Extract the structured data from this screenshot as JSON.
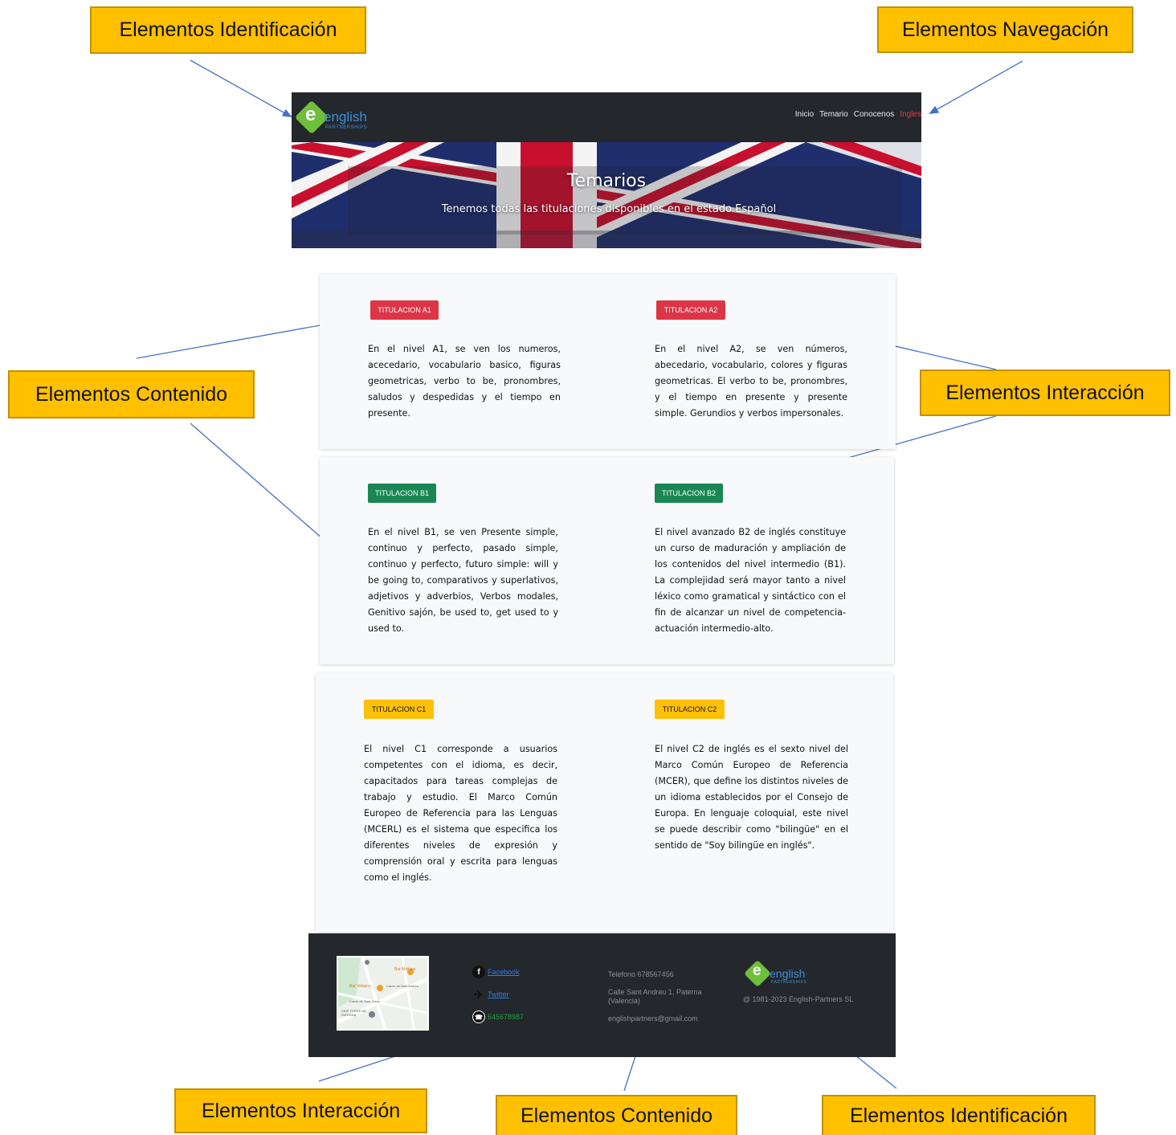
{
  "annotations": {
    "top_left": "Elementos Identificación",
    "top_right": "Elementos Navegación",
    "mid_left": "Elementos Contenido",
    "mid_right": "Elementos Interacción",
    "bottom_left": "Elementos Interacción",
    "bottom_center": "Elementos Contenido",
    "bottom_right": "Elementos Identificación"
  },
  "brand": {
    "mark": "e",
    "word": "english",
    "sub": "PARTNERSHIPS",
    "mark_color": "#6fbf3b",
    "word_color": "#3d8fd9"
  },
  "nav": {
    "items": [
      "Inicio",
      "Temario",
      "Conocenos"
    ],
    "active": "Ingles",
    "active_color": "#e23a4a"
  },
  "hero": {
    "title": "Temarios",
    "subtitle": "Tenemos todas las titulaciones disponibles en el estado Español"
  },
  "levels": [
    {
      "badge": "TITULACION A1",
      "color": "#dc3545",
      "text": "En el nivel A1, se ven los numeros, acecedario, vocabulario basico, figuras geometricas, verbo to be, pronombres, saludos y despedidas y el tiempo en presente."
    },
    {
      "badge": "TITULACION A2",
      "color": "#dc3545",
      "text": "En el nivel A2, se ven números, abecedario, vocabulario, colores y figuras geometricas. El verbo to be, pronombres, y el tiempo en presente y presente simple. Gerundios y verbos impersonales."
    },
    {
      "badge": "TITULACION B1",
      "color": "#198754",
      "text": "En el nivel B1, se ven Presente simple, continuo y perfecto, pasado simple, continuo y perfecto, futuro simple: will y be going to, comparativos y superlativos, adjetivos y adverbios, Verbos modales, Genitivo sajón, be used to, get used to y used to."
    },
    {
      "badge": "TITULACION B2",
      "color": "#198754",
      "text": "El nivel avanzado B2 de inglés constituye un curso de maduración y ampliación de los contenidos del nivel intermedio (B1). La complejidad será mayor tanto a nivel léxico como gramatical y sintáctico con el fin de alcanzar un nivel de competencia-actuación intermedio-alto."
    },
    {
      "badge": "TITULACION C1",
      "color": "#ffc107",
      "text": "El nivel C1 corresponde a usuarios competentes con el idioma, es decir, capacitados para tareas complejas de trabajo y estudio. El Marco Común Europeo de Referencia para las Lenguas (MCERL) es el sistema que especifica los diferentes niveles de expresión y comprensión oral y escrita para lenguas como el inglés."
    },
    {
      "badge": "TITULACION C2",
      "color": "#ffc107",
      "text": "El nivel C2 de inglés es el sexto nivel del Marco Común Europeo de Referencia (MCER), que define los distintos niveles de un idioma establecidos por el Consejo de Europa. En lenguaje coloquial, este nivel se puede describir como \"bilingüe\" en el sentido de \"Soy bilingüe en inglés\"."
    }
  ],
  "footer": {
    "social": [
      {
        "icon": "facebook-icon",
        "label": "Facebook"
      },
      {
        "icon": "twitter-icon",
        "label": "Twitter"
      },
      {
        "icon": "whatsapp-icon",
        "label": "645678987"
      }
    ],
    "phone": "Telefono 678567456",
    "address_line1": "Calle Sant Andreu 1, Paterna",
    "address_line2": "(Valencia)",
    "email": "englishpartners@gmail.com",
    "copyright": "@ 1981-2023 English-Partners SL",
    "map_labels": [
      "Bar Melissa",
      "Bar Velasco",
      "Carrer de Sant Andreu",
      "Carrer de Sant Jesús",
      "CEIP TORRE DE PATERNA"
    ]
  }
}
